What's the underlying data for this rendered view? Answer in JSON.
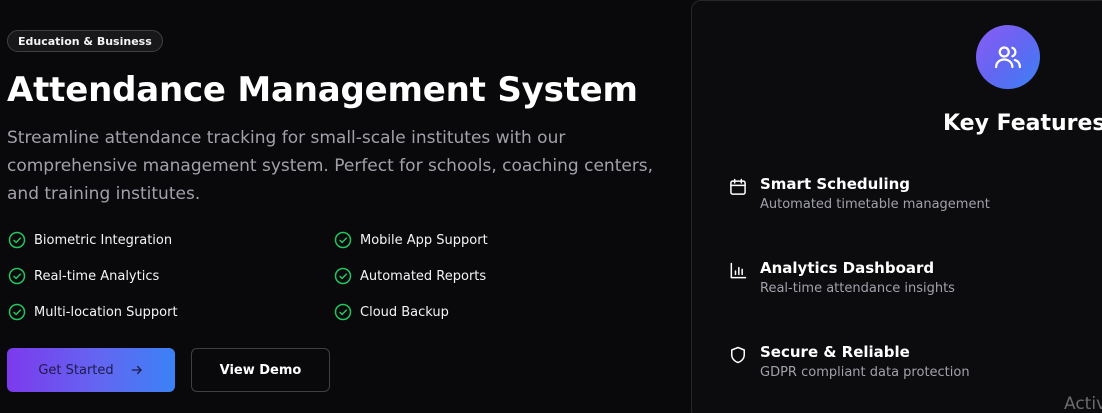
{
  "hero": {
    "badge": "Education & Business",
    "title": "Attendance Management System",
    "description": "Streamline attendance tracking for small-scale institutes with our comprehensive management system. Perfect for schools, coaching centers, and training institutes.",
    "features": [
      "Biometric Integration",
      "Mobile App Support",
      "Real-time Analytics",
      "Automated Reports",
      "Multi-location Support",
      "Cloud Backup"
    ],
    "primary_button": "Get Started",
    "secondary_button": "View Demo"
  },
  "panel": {
    "icon": "users-icon",
    "title": "Key Features",
    "items": [
      {
        "icon": "calendar-icon",
        "title": "Smart Scheduling",
        "subtitle": "Automated timetable management"
      },
      {
        "icon": "bar-chart-icon",
        "title": "Analytics Dashboard",
        "subtitle": "Real-time attendance insights"
      },
      {
        "icon": "shield-icon",
        "title": "Secure & Reliable",
        "subtitle": "GDPR compliant data protection"
      }
    ]
  },
  "watermark": "Activ",
  "colors": {
    "background": "#09090b",
    "check_green": "#22c55e",
    "gradient_start": "#7c3aed",
    "gradient_end": "#3b82f6",
    "muted_text": "#a1a1aa"
  }
}
